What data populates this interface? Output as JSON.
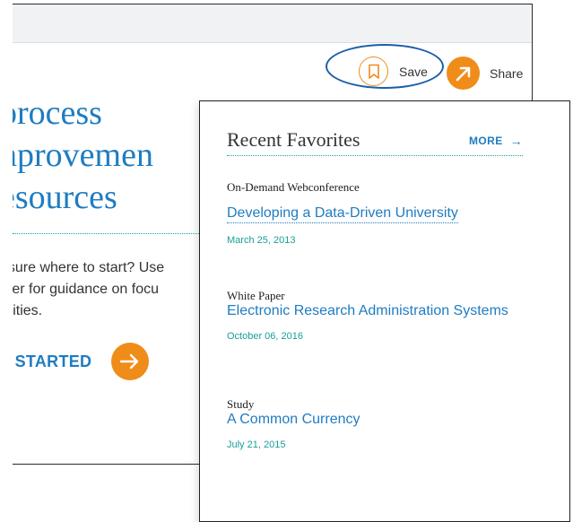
{
  "toolbar": {
    "save_label": "Save",
    "share_label": "Share"
  },
  "hero": {
    "title_lines": [
      "process",
      "nprovemen",
      "esources"
    ],
    "text_lines": [
      "t sure where to start? Use",
      "nter for guidance on focu",
      "orities."
    ],
    "cta_label": "T STARTED"
  },
  "favorites": {
    "title": "Recent Favorites",
    "more_label": "MORE",
    "items": [
      {
        "type": "On-Demand Webconference",
        "title": "Developing a Data-Driven University",
        "date": "March 25, 2013"
      },
      {
        "type": "White Paper",
        "title": "Electronic Research Administration Systems",
        "date": "October 06, 2016"
      },
      {
        "type": "Study",
        "title": "A Common Currency",
        "date": "July 21, 2015"
      }
    ]
  },
  "colors": {
    "accent_orange": "#f08c1a",
    "link_blue": "#1f7cc1",
    "teal": "#1a9e97",
    "highlight_oval": "#1b5ea9"
  },
  "icons": {
    "save": "bookmark-icon",
    "share": "arrow-up-right-icon",
    "cta": "arrow-right-icon",
    "more": "arrow-right-icon"
  }
}
